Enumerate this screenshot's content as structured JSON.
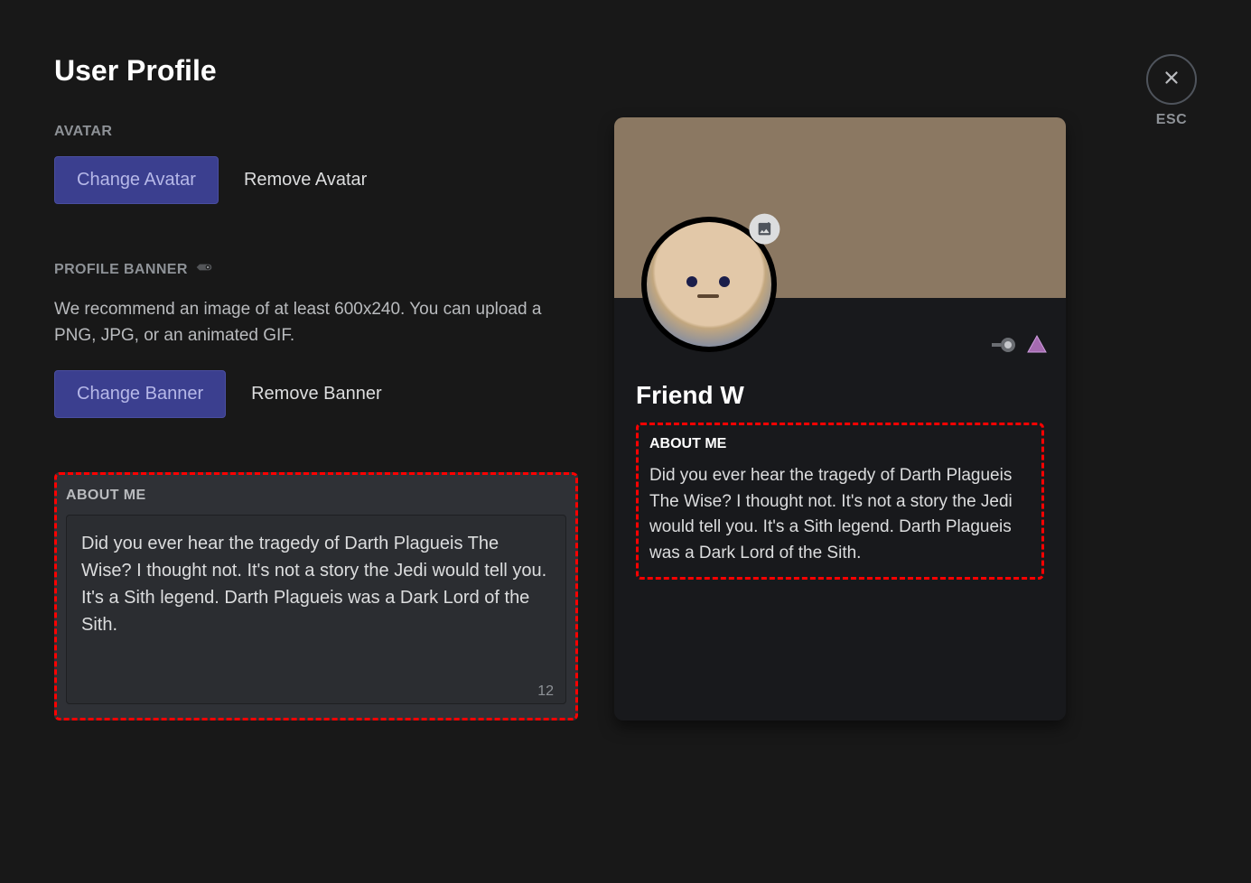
{
  "page": {
    "title": "User Profile"
  },
  "close": {
    "label": "ESC"
  },
  "avatar_section": {
    "label": "AVATAR",
    "change_btn": "Change Avatar",
    "remove_btn": "Remove Avatar"
  },
  "banner_section": {
    "label": "PROFILE BANNER",
    "help": "We recommend an image of at least 600x240. You can upload a PNG, JPG, or an animated GIF.",
    "change_btn": "Change Banner",
    "remove_btn": "Remove Banner"
  },
  "about_section": {
    "label": "ABOUT ME",
    "text": "Did you ever hear the tragedy of Darth Plagueis The Wise? I thought not. It's not a story the Jedi would tell you. It's a Sith legend. Darth Plagueis was a Dark Lord of the Sith.",
    "char_remaining": "12"
  },
  "preview": {
    "username": "Friend W",
    "about_label": "ABOUT ME",
    "about_text": "Did you ever hear the tragedy of Darth Plagueis The Wise? I thought not. It's not a story the Jedi would tell you. It's a Sith legend. Darth Plagueis was a Dark Lord of the Sith."
  }
}
